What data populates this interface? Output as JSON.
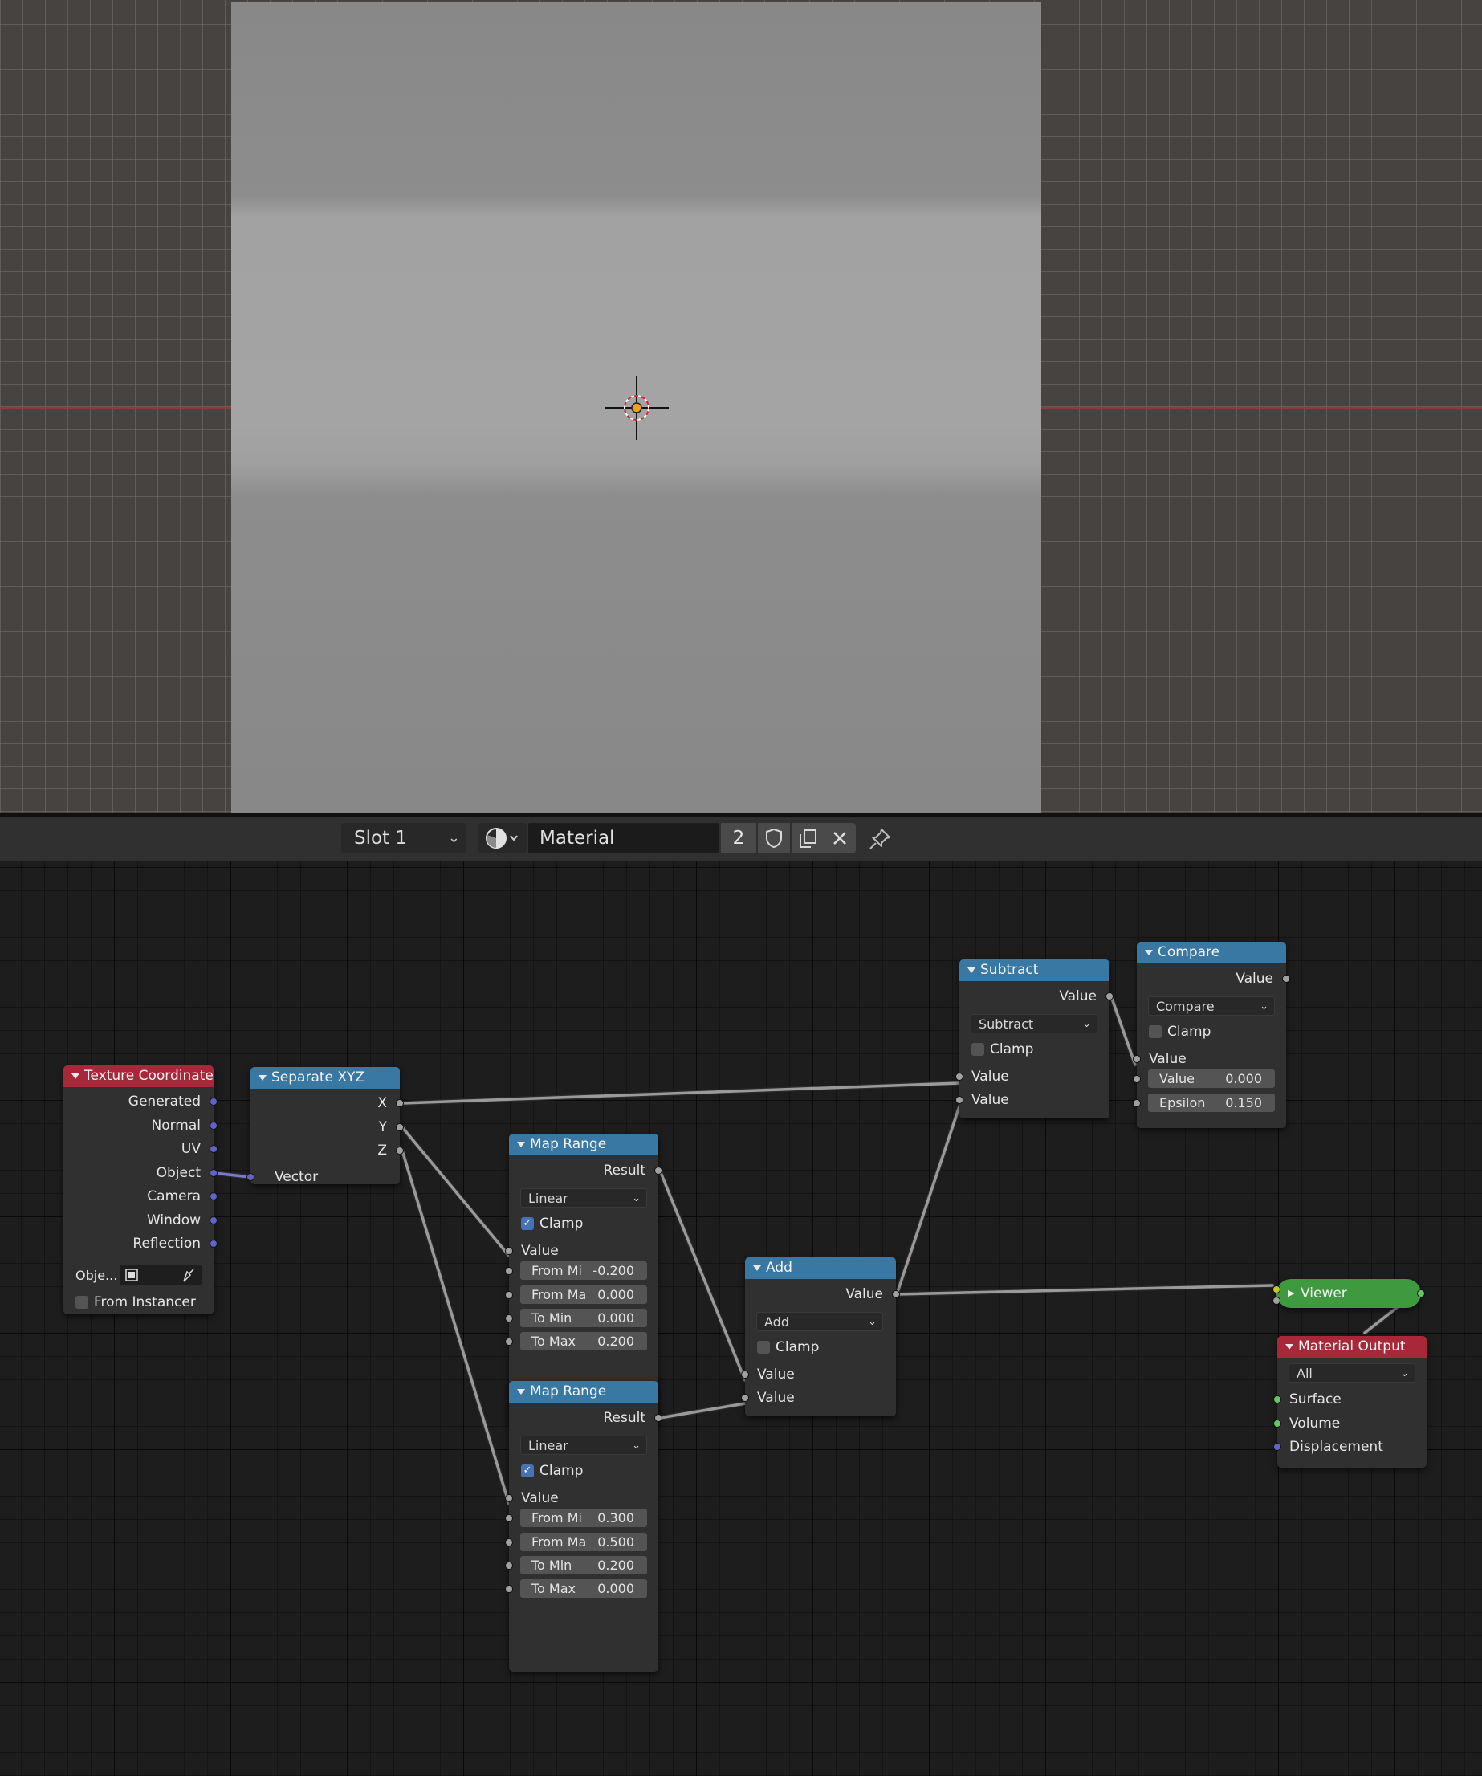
{
  "header": {
    "slot": "Slot 1",
    "material_name": "Material",
    "user_count": "2"
  },
  "nodes": {
    "texture_coordinate": {
      "title": "Texture Coordinate",
      "outputs": [
        "Generated",
        "Normal",
        "UV",
        "Object",
        "Camera",
        "Window",
        "Reflection"
      ],
      "object_label": "Obje...",
      "from_instancer": "From Instancer"
    },
    "separate_xyz": {
      "title": "Separate XYZ",
      "outputs": [
        "X",
        "Y",
        "Z"
      ],
      "input": "Vector"
    },
    "map_range_1": {
      "title": "Map Range",
      "output": "Result",
      "interpolation": "Linear",
      "clamp": "Clamp",
      "input": "Value",
      "fields": [
        {
          "label": "From Mi",
          "value": "-0.200"
        },
        {
          "label": "From Ma",
          "value": "0.000"
        },
        {
          "label": "To Min",
          "value": "0.000"
        },
        {
          "label": "To Max",
          "value": "0.200"
        }
      ]
    },
    "map_range_2": {
      "title": "Map Range",
      "output": "Result",
      "interpolation": "Linear",
      "clamp": "Clamp",
      "input": "Value",
      "fields": [
        {
          "label": "From Mi",
          "value": "0.300"
        },
        {
          "label": "From Ma",
          "value": "0.500"
        },
        {
          "label": "To Min",
          "value": "0.200"
        },
        {
          "label": "To Max",
          "value": "0.000"
        }
      ]
    },
    "add": {
      "title": "Add",
      "output": "Value",
      "operation": "Add",
      "clamp": "Clamp",
      "inputs": [
        "Value",
        "Value"
      ]
    },
    "subtract": {
      "title": "Subtract",
      "output": "Value",
      "operation": "Subtract",
      "clamp": "Clamp",
      "inputs": [
        "Value",
        "Value"
      ]
    },
    "compare": {
      "title": "Compare",
      "output": "Value",
      "operation": "Compare",
      "clamp": "Clamp",
      "input": "Value",
      "fields": [
        {
          "label": "Value",
          "value": "0.000"
        },
        {
          "label": "Epsilon",
          "value": "0.150"
        }
      ]
    },
    "viewer": {
      "title": "Viewer"
    },
    "material_output": {
      "title": "Material Output",
      "target": "All",
      "inputs": [
        "Surface",
        "Volume",
        "Displacement"
      ]
    }
  },
  "colors": {
    "shader_header": "#a8283a",
    "converter_header": "#3a78a4",
    "viewer": "#3f9a3f",
    "socket_float": "#a1a1a1",
    "socket_vector": "#6363c7",
    "socket_shader": "#63c763",
    "checkbox_on": "#4772b3"
  }
}
